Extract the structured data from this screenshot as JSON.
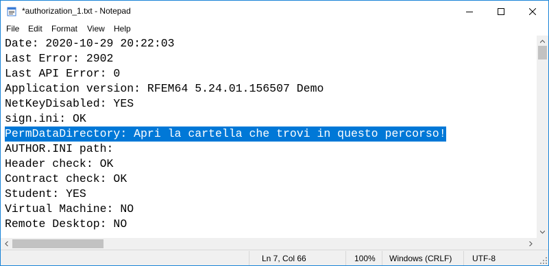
{
  "window": {
    "title": "*authorization_1.txt - Notepad",
    "icon": "notepad-icon",
    "controls": [
      "minimize-icon",
      "maximize-icon",
      "close-icon"
    ]
  },
  "menu": {
    "items": [
      {
        "label": "File"
      },
      {
        "label": "Edit"
      },
      {
        "label": "Format"
      },
      {
        "label": "View"
      },
      {
        "label": "Help"
      }
    ]
  },
  "editor": {
    "lines": [
      "Date: 2020-10-29 20:22:03",
      "Last Error: 2902",
      "Last API Error: 0",
      "Application version: RFEM64 5.24.01.156507 Demo",
      "NetKeyDisabled: YES",
      "sign.ini: OK",
      "PermDataDirectory: Apri la cartella che trovi in questo percorso!",
      "AUTHOR.INI path:",
      "Header check: OK",
      "Contract check: OK",
      "Student: YES",
      "Virtual Machine: NO",
      "Remote Desktop: NO"
    ],
    "selected_line": 7,
    "selection_color": "#0078d7"
  },
  "status": {
    "position": "Ln 7, Col 66",
    "zoom": "100%",
    "line_ending": "Windows (CRLF)",
    "encoding": "UTF-8"
  },
  "colors": {
    "border": "#1883d7",
    "selection": "#0078d7",
    "statusbar": "#f0f0f0"
  }
}
